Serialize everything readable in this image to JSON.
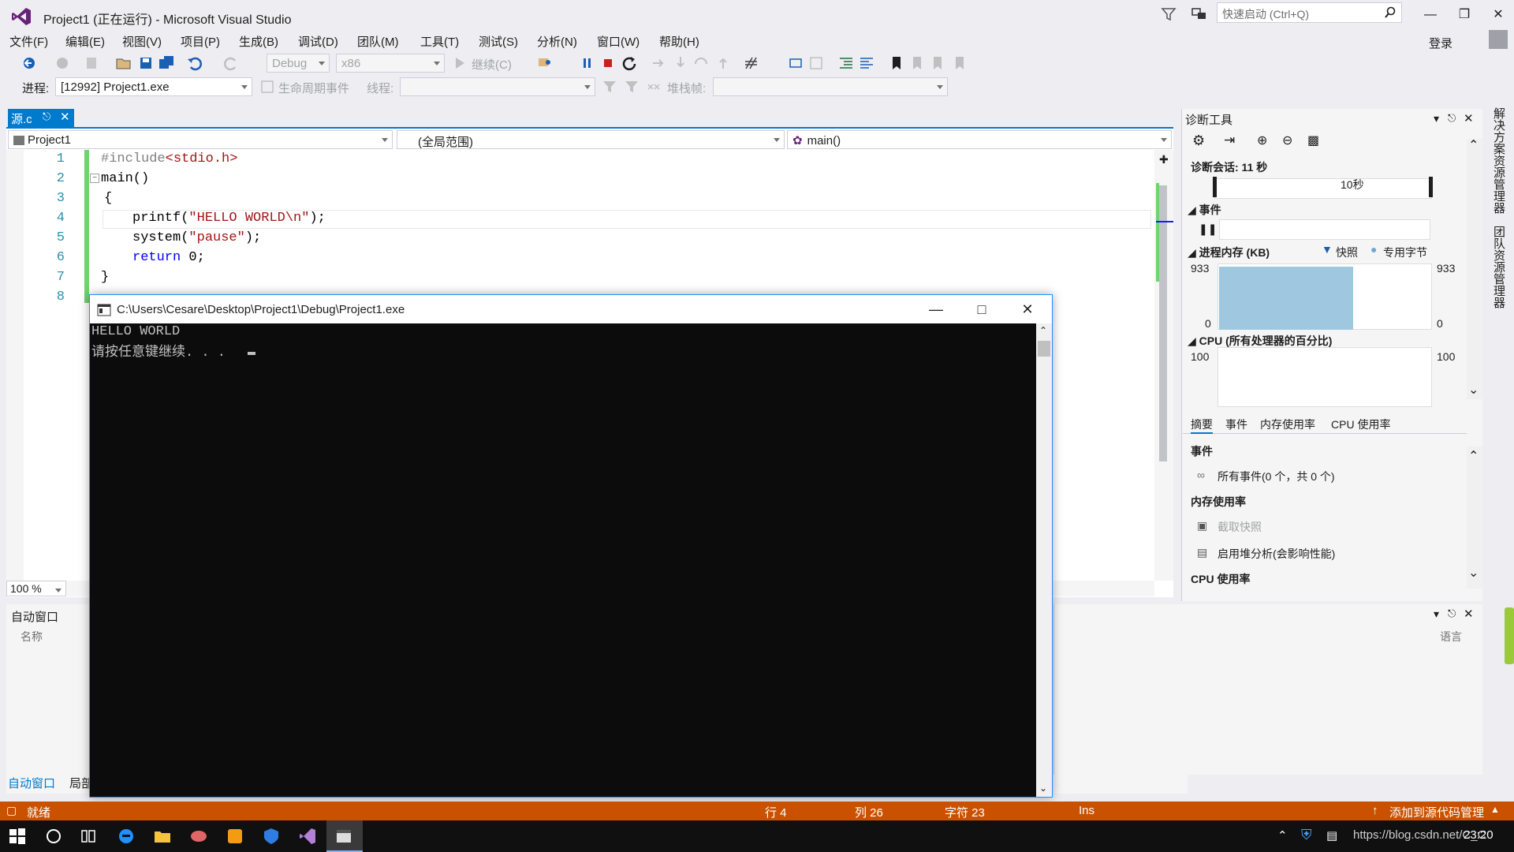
{
  "window": {
    "title": "Project1 (正在运行) - Microsoft Visual Studio"
  },
  "quick_launch": {
    "placeholder": "快速启动 (Ctrl+Q)"
  },
  "menu": [
    "文件(F)",
    "编辑(E)",
    "视图(V)",
    "项目(P)",
    "生成(B)",
    "调试(D)",
    "团队(M)",
    "工具(T)",
    "测试(S)",
    "分析(N)",
    "窗口(W)",
    "帮助(H)"
  ],
  "login": "登录",
  "toolbar": {
    "config": "Debug",
    "platform": "x86",
    "continue": "继续(C)",
    "process_label": "进程:",
    "process_value": "[12992] Project1.exe",
    "lifecycle": "生命周期事件",
    "thread_label": "线程:",
    "stack_label": "堆栈帧:"
  },
  "editor": {
    "tab": "源.c",
    "project_combo": "Project1",
    "scope_combo": "(全局范围)",
    "function_combo": "main()",
    "zoom": "100 %",
    "line_numbers": [
      "1",
      "2",
      "3",
      "4",
      "5",
      "6",
      "7",
      "8"
    ],
    "code": {
      "l1_pp": "#include",
      "l1_inc": "<stdio.h>",
      "l2": "main()",
      "l3": "{",
      "l4_a": "printf(",
      "l4_str": "\"HELLO WORLD\\n\"",
      "l4_b": ");",
      "l5_a": "system(",
      "l5_str": "\"pause\"",
      "l5_b": ");",
      "l6_kw": "return",
      "l6_b": " 0;",
      "l7": "}"
    }
  },
  "console": {
    "title": "C:\\Users\\Cesare\\Desktop\\Project1\\Debug\\Project1.exe",
    "line1": "HELLO WORLD",
    "line2": "请按任意键继续. . ."
  },
  "autos": {
    "title": "自动窗口",
    "col_name": "名称",
    "col_lang": "语言",
    "tab1": "自动窗口",
    "tab2": "局部"
  },
  "diagnostics": {
    "title": "诊断工具",
    "session": "诊断会话: 11 秒",
    "timeline_tick": "10秒",
    "events_section": "事件",
    "memory_section": "进程内存 (KB)",
    "legend_snapshot": "快照",
    "legend_private": "专用字节",
    "mem_max_left": "933",
    "mem_min_left": "0",
    "mem_max_right": "933",
    "mem_min_right": "0",
    "cpu_section": "CPU (所有处理器的百分比)",
    "cpu_max_left": "100",
    "cpu_max_right": "100",
    "tabs": [
      "摘要",
      "事件",
      "内存使用率",
      "CPU 使用率"
    ],
    "summary_events_header": "事件",
    "all_events": "所有事件(0 个，共 0 个)",
    "memory_header": "内存使用率",
    "take_snapshot": "截取快照",
    "heap_analysis": "启用堆分析(会影响性能)",
    "cpu_header": "CPU 使用率",
    "mem_fill_fraction": 0.63
  },
  "side_tabs": [
    "解决方案资源管理器",
    "团队资源管理器"
  ],
  "status": {
    "ready": "就绪",
    "line": "行 4",
    "col": "列 26",
    "char": "字符 23",
    "ins": "Ins",
    "source_control": "添加到源代码管理"
  },
  "taskbar": {
    "time": "23:20",
    "url_fragment": "https://blog.csdn.net/C_C"
  },
  "colors": {
    "accent": "#007acc",
    "status_debug": "#ca5100",
    "console_bg": "#0c0c0c"
  }
}
